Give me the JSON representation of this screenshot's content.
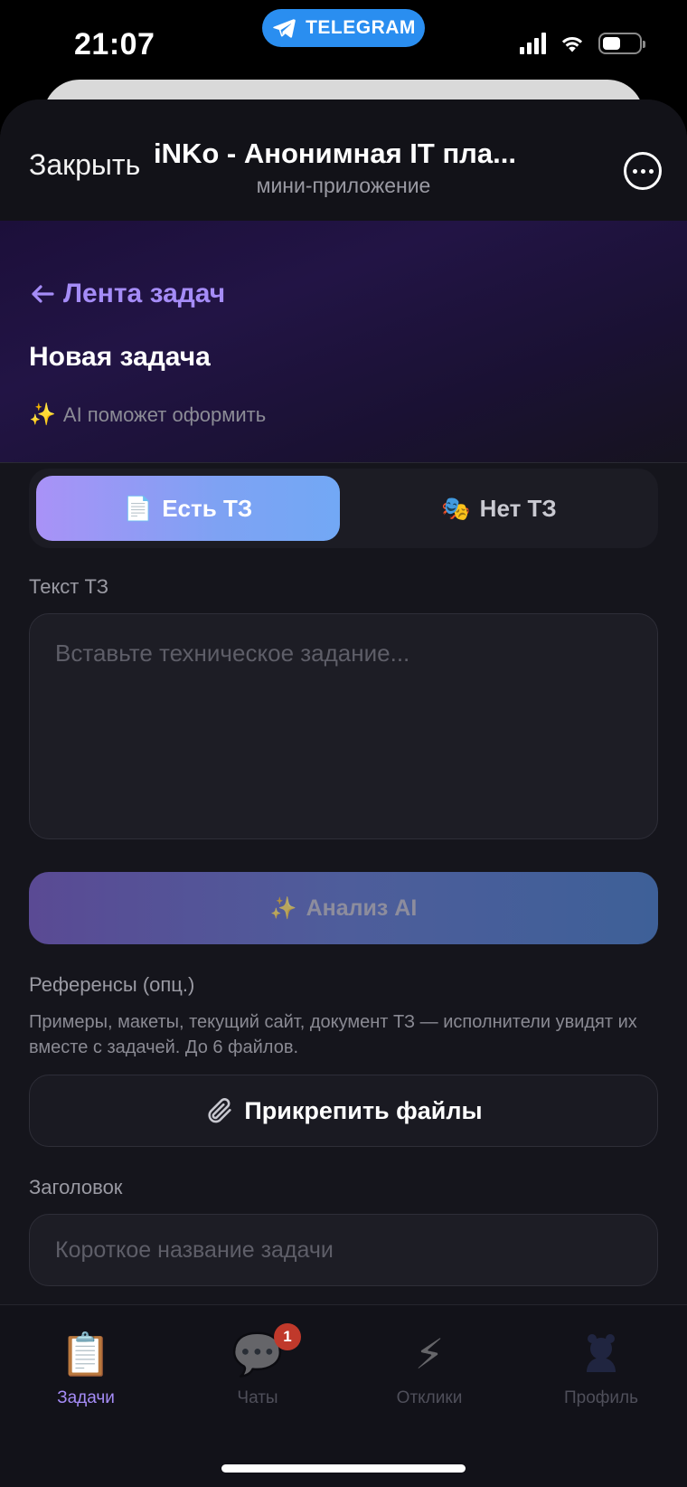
{
  "status_bar": {
    "time": "21:07",
    "app_pill": "TELEGRAM",
    "battery_level": 0.5
  },
  "header": {
    "close_label": "Закрыть",
    "title": "iNKo - Анонимная IT пла...",
    "subtitle": "мини-приложение",
    "more_icon": "more-icon"
  },
  "hero": {
    "back_link": "Лента задач",
    "page_title": "Новая задача",
    "ai_hint": "AI поможет оформить"
  },
  "segmented": {
    "options": [
      {
        "label": "Есть ТЗ",
        "emoji": "📄",
        "active": true
      },
      {
        "label": "Нет ТЗ",
        "emoji": "🎭",
        "active": false
      }
    ]
  },
  "form": {
    "spec_label": "Текст ТЗ",
    "spec_placeholder": "Вставьте техническое задание...",
    "ai_button": "Анализ AI",
    "refs_label": "Референсы (опц.)",
    "refs_description": "Примеры, макеты, текущий сайт, документ ТЗ — исполнители увидят их вместе с задачей. До 6 файлов.",
    "attach_button": "Прикрепить файлы",
    "title_label": "Заголовок",
    "title_placeholder": "Короткое название задачи"
  },
  "tab_bar": {
    "tabs": [
      {
        "label": "Задачи",
        "icon": "clipboard-icon",
        "active": true
      },
      {
        "label": "Чаты",
        "icon": "chat-bubble-icon",
        "badge": "1",
        "active": false
      },
      {
        "label": "Отклики",
        "icon": "lightning-icon",
        "active": false
      },
      {
        "label": "Профиль",
        "icon": "profile-icon",
        "active": false
      }
    ]
  },
  "colors": {
    "accent": "#a58cf7",
    "telegram": "#2a8ef0",
    "background": "#15151c",
    "badge": "#c0392b"
  }
}
